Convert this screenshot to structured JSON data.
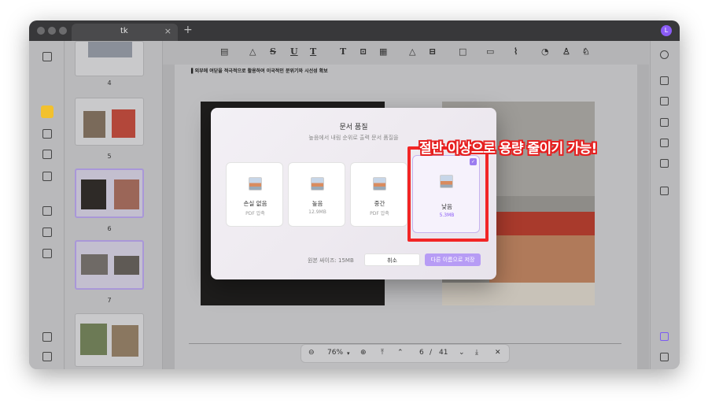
{
  "tab": {
    "title": "tk",
    "close": "×",
    "add": "+"
  },
  "avatar": "L",
  "toolbar": {
    "icons": [
      "comment-icon",
      "highlighter-icon",
      "strikethrough-icon",
      "underline-icon",
      "squiggly-icon",
      "text-icon",
      "textbox-icon",
      "note-icon",
      "pen-icon",
      "eraser-icon",
      "shape-icon",
      "measure-icon",
      "attachment-icon",
      "sticker-icon",
      "stamp-icon",
      "signature-icon"
    ],
    "glyphs": [
      "▤",
      "△",
      "S",
      "U",
      "T",
      "T",
      "⊡",
      "▦",
      "△",
      "⊟",
      "□",
      "▭",
      "⌇",
      "◔",
      "♙",
      "♘"
    ]
  },
  "thumbnails": [
    {
      "page": "4"
    },
    {
      "page": "5"
    },
    {
      "page": "6"
    },
    {
      "page": "7"
    }
  ],
  "document": {
    "heading": "▌외부에 여닫을 적극적으로 활용하여 이국적인 분위기와 시선성 확보"
  },
  "dialog": {
    "title": "문서 품질",
    "subtitle": "높음에서 내림 순위로 출력 문서 품질을",
    "options": [
      {
        "name": "손실 없음",
        "size": "PDF 압축"
      },
      {
        "name": "높음",
        "size": "12.9MB"
      },
      {
        "name": "중간",
        "size": "PDF 압축"
      },
      {
        "name": "낮음",
        "size": "5.3MB"
      }
    ],
    "original_size": "원본 싸이즈: 15MB",
    "cancel": "취소",
    "save_as": "다른 이름으로 저장",
    "check": "✓"
  },
  "annotation": "절반 이상으로 용량 줄이기 가능!",
  "bottombar": {
    "zoom_out": "⊖",
    "zoom": "76%",
    "zoom_caret": "▾",
    "zoom_in": "⊕",
    "first": "⤒",
    "prev": "⌃",
    "page": "6",
    "separator": "/",
    "total": "41",
    "next": "⌄",
    "last": "⤓",
    "close": "✕"
  },
  "colors": {
    "accent": "#8b5cf6",
    "highlight_red": "#f22525",
    "avatar": "#8b5cf6"
  }
}
